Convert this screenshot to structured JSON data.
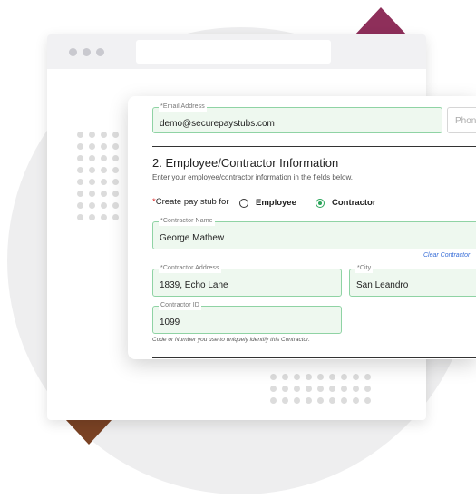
{
  "form": {
    "email": {
      "label": "*Email Address",
      "value": "demo@securepaystubs.com"
    },
    "phone": {
      "placeholder": "Phon"
    },
    "section": {
      "title": "2. Employee/Contractor Information",
      "subtitle": "Enter your employee/contractor information in the fields below."
    },
    "stub_for": {
      "required_mark": "*",
      "label": "Create pay stub for",
      "options": [
        {
          "label": "Employee",
          "selected": false
        },
        {
          "label": "Contractor",
          "selected": true
        }
      ]
    },
    "contractor_name": {
      "label": "*Contractor Name",
      "value": "George Mathew"
    },
    "clear_link": "Clear Contractor",
    "contractor_address": {
      "label": "*Contractor Address",
      "value": "1839, Echo Lane"
    },
    "city": {
      "label": "*City",
      "value": "San Leandro"
    },
    "contractor_id": {
      "label": "Contractor ID",
      "value": "1099"
    },
    "contractor_id_help": "Code or Number you use to uniquely identify this Contractor."
  },
  "colors": {
    "accent_green": "#2aa55a",
    "field_fill": "#eef8ef",
    "field_border": "#8fd3a4",
    "decor_top": "#8e2f5a",
    "decor_bottom": "#7a4224"
  }
}
